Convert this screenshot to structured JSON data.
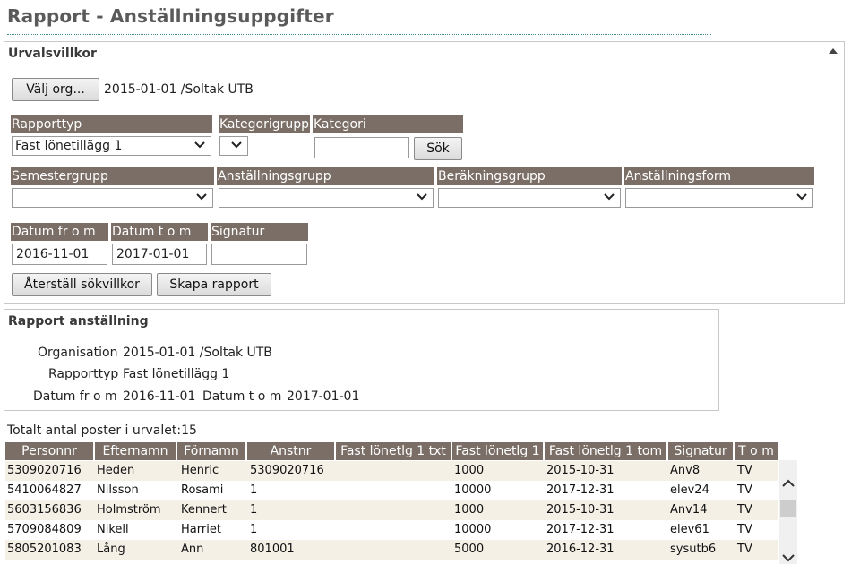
{
  "page_title": "Rapport - Anställningsuppgifter",
  "criteria": {
    "title": "Urvalsvillkor",
    "choose_org_button": "Välj org...",
    "org_value": "2015-01-01 /Soltak UTB",
    "rapporttyp": {
      "label": "Rapporttyp",
      "value": "Fast lönetillägg 1"
    },
    "kategorigrupp": {
      "label": "Kategorigrupp",
      "value": ""
    },
    "kategori": {
      "label": "Kategori",
      "value": ""
    },
    "search_button": "Sök",
    "semestergrupp": {
      "label": "Semestergrupp",
      "value": ""
    },
    "anstallningsgrupp": {
      "label": "Anställningsgrupp",
      "value": ""
    },
    "berakningsgrupp": {
      "label": "Beräkningsgrupp",
      "value": ""
    },
    "anstallningsform": {
      "label": "Anställningsform",
      "value": ""
    },
    "datum_from": {
      "label": "Datum fr o m",
      "value": "2016-11-01"
    },
    "datum_tom": {
      "label": "Datum t o m",
      "value": "2017-01-01"
    },
    "signatur": {
      "label": "Signatur",
      "value": ""
    },
    "reset_button": "Återställ sökvillkor",
    "create_button": "Skapa rapport"
  },
  "report": {
    "title": "Rapport anställning",
    "org_label": "Organisation",
    "org_value": "2015-01-01 /Soltak UTB",
    "type_label": "Rapporttyp",
    "type_value": "Fast lönetillägg 1",
    "from_label": "Datum fr o m",
    "from_value": "2016-11-01",
    "tom_label": "Datum t o m",
    "tom_value": "2017-01-01"
  },
  "total_text": "Totalt antal poster i urvalet:15",
  "table": {
    "columns": [
      "Personnr",
      "Efternamn",
      "Förnamn",
      "Anstnr",
      "Fast lönetlg 1 txt",
      "Fast lönetlg 1",
      "Fast lönetlg 1 tom",
      "Signatur",
      "T o m"
    ],
    "rows": [
      [
        "5309020716",
        "Heden",
        "Henric",
        "5309020716",
        "",
        "1000",
        "2015-10-31",
        "Anv8",
        "TV"
      ],
      [
        "5410064827",
        "Nilsson",
        "Rosami",
        "1",
        "",
        "10000",
        "2017-12-31",
        "elev24",
        "TV"
      ],
      [
        "5603156836",
        "Holmström",
        "Kennert",
        "1",
        "",
        "1000",
        "2015-10-31",
        "Anv14",
        "TV"
      ],
      [
        "5709084809",
        "Nikell",
        "Harriet",
        "1",
        "",
        "10000",
        "2017-12-31",
        "elev61",
        "TV"
      ],
      [
        "5805201083",
        "Lång",
        "Ann",
        "801001",
        "",
        "5000",
        "2016-12-31",
        "sysutb6",
        "TV"
      ]
    ]
  }
}
